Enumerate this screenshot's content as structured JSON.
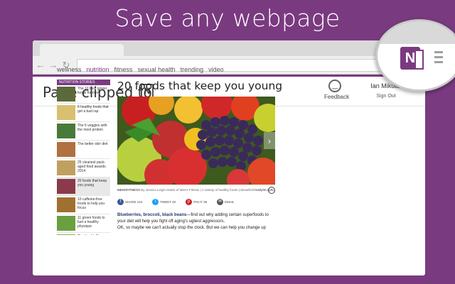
{
  "headline": "Save any webpage",
  "browser": {
    "nav": {
      "back": "←",
      "forward": "→",
      "reload": "↻"
    }
  },
  "app": {
    "title": "Page clipped to",
    "logo_letter": "N",
    "feedback_label": "Feedback",
    "user_name": "Ian Mikutel",
    "sign_out": "Sign Out"
  },
  "topnav": [
    "wellness",
    "nutrition",
    "fitness",
    "sexual health",
    "trending",
    "video"
  ],
  "topnav_active": "nutrition",
  "sidebar": {
    "header": "NUTRITION STORIES",
    "items": [
      {
        "text": "The 10 best power foods for men",
        "color": "#5a6a3a"
      },
      {
        "text": "6 healthy foods that get a bad rap",
        "color": "#d8c070"
      },
      {
        "text": "The 6 veggies with the most protein",
        "color": "#4a7a3a"
      },
      {
        "text": "The better skin diet",
        "color": "#b07040"
      },
      {
        "text": "25 cleanest pack-aged food awards 2014",
        "color": "#c0a060"
      },
      {
        "text": "20 foods that keep you young",
        "color": "#8a3a4a"
      },
      {
        "text": "10 caffeine-free foods to help you focus",
        "color": "#a07030"
      },
      {
        "text": "11 green foods to fuel a healthy physique",
        "color": "#6aa040"
      },
      {
        "text": "The Health Oscars:",
        "color": "#8ab050"
      }
    ],
    "selected_index": 5
  },
  "article": {
    "title": "20 foods that keep you young",
    "caption_source": "MENSFITNESS",
    "caption_text": "By Jessica Leigh Hester of Men's Fitness | A variety of healthy foods (Alexa/EIG/Getty Images)",
    "counter": "1 of 21",
    "share": [
      {
        "label": "SHARE",
        "count": "144",
        "icon": "facebook-icon",
        "color": "#3b5998",
        "glyph": "f"
      },
      {
        "label": "TWEET",
        "count": "20",
        "icon": "twitter-icon",
        "color": "#1da1f2",
        "glyph": "t"
      },
      {
        "label": "PIN IT",
        "count": "36",
        "icon": "pinterest-icon",
        "color": "#cb2027",
        "glyph": "p"
      },
      {
        "label": "EMAIL",
        "count": "",
        "icon": "email-icon",
        "color": "#555555",
        "glyph": "✉"
      }
    ],
    "lead_bold": "Blueberries, broccoli, black beans",
    "lead_rest": "—find out why adding certain superfoods to your diet will help you fight off aging's ugliest aggressors.",
    "para2": "OK, so maybe we can't actually stop the clock. But we can help you change up"
  },
  "colors": {
    "brand": "#7a3a80",
    "background": "#7a3a80"
  }
}
